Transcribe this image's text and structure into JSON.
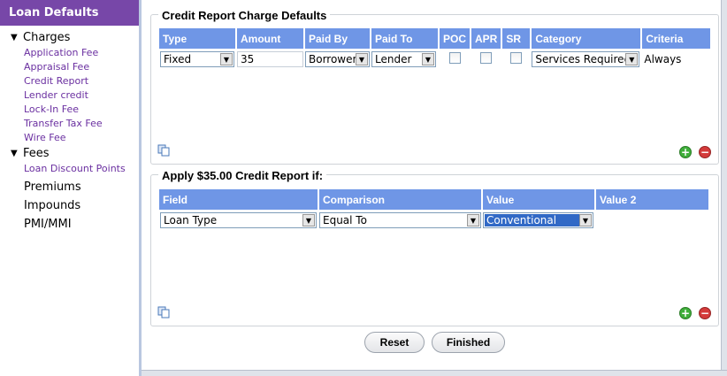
{
  "sidebar": {
    "title": "Loan Defaults",
    "groups": [
      {
        "label": "Charges",
        "items": [
          "Application Fee",
          "Appraisal Fee",
          "Credit Report",
          "Lender credit",
          "Lock-In Fee",
          "Transfer Tax Fee",
          "Wire Fee"
        ]
      },
      {
        "label": "Fees",
        "items": [
          "Loan Discount Points"
        ]
      }
    ],
    "plain_items": [
      "Premiums",
      "Impounds",
      "PMI/MMI"
    ]
  },
  "charge_panel": {
    "title": "Credit Report Charge Defaults",
    "headers": [
      "Type",
      "Amount",
      "Paid By",
      "Paid To",
      "POC",
      "APR",
      "SR",
      "Category",
      "Criteria"
    ],
    "row": {
      "type": "Fixed",
      "amount": "35",
      "paid_by": "Borrower",
      "paid_to": "Lender",
      "poc": false,
      "apr": false,
      "sr": false,
      "category": "Services Required",
      "criteria": "Always"
    }
  },
  "condition_panel": {
    "title": "Apply $35.00 Credit Report if:",
    "headers": [
      "Field",
      "Comparison",
      "Value",
      "Value 2"
    ],
    "row": {
      "field": "Loan Type",
      "comparison": "Equal To",
      "value": "Conventional"
    }
  },
  "buttons": {
    "reset": "Reset",
    "finished": "Finished"
  },
  "colors": {
    "sidebar_header": "#7747a8",
    "table_header": "#6f96e6",
    "link": "#6a2fa0"
  }
}
